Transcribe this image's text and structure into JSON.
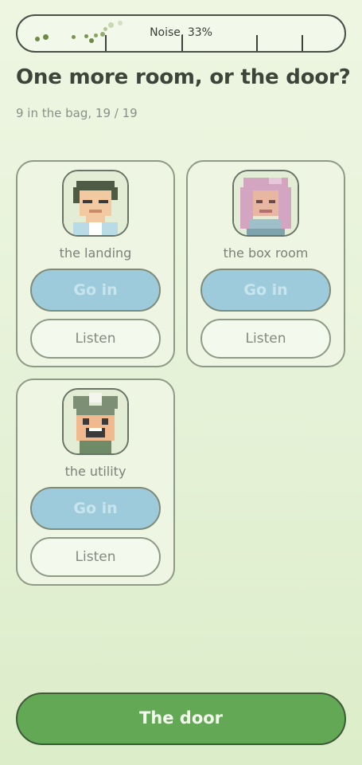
{
  "noise": {
    "label": "Noise",
    "value_text": "33%",
    "level": 0.33
  },
  "title": "One more room, or the door?",
  "subtitle": "9 in the bag, 19 / 19",
  "rooms": [
    {
      "name": "the landing",
      "go_label": "Go in",
      "listen_label": "Listen",
      "portrait": "man-portrait-icon"
    },
    {
      "name": "the box room",
      "go_label": "Go in",
      "listen_label": "Listen",
      "portrait": "woman-portrait-icon"
    },
    {
      "name": "the utility",
      "go_label": "Go in",
      "listen_label": "Listen",
      "portrait": "kid-portrait-icon"
    }
  ],
  "door_label": "The door",
  "colors": {
    "accent_green": "#63a955",
    "go_blue": "#9ecbdb",
    "card_bg": "#eef6e3",
    "text_dark": "#3d453b"
  }
}
